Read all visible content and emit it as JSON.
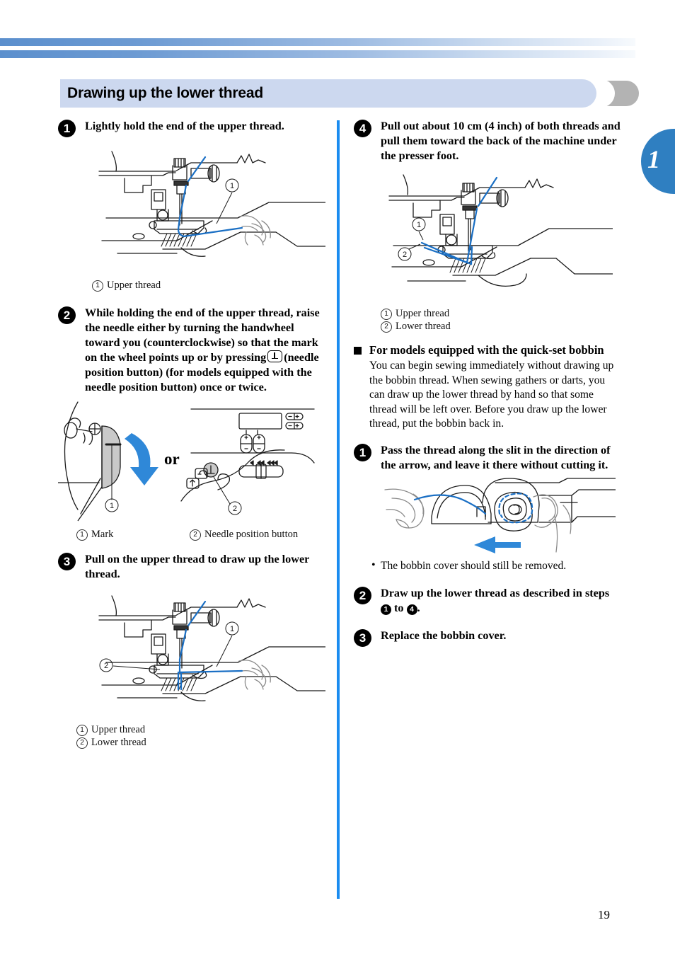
{
  "header": {
    "title": "Drawing up the lower thread",
    "chapter_tab": "1"
  },
  "page_number": "19",
  "left_column": {
    "step1": {
      "badge": "1",
      "text": "Lightly hold the end of the upper thread.",
      "caption": [
        {
          "num": "①",
          "label": "Upper thread"
        }
      ]
    },
    "step2": {
      "badge": "2",
      "text_part1": "While holding the end of the upper thread, raise the needle either by turning the handwheel toward you (counterclockwise) so that the mark on the wheel points up or by pressing",
      "text_part2": "(needle position button) (for models equipped with the needle position button) once or twice.",
      "or_label": "or",
      "caption": [
        {
          "num": "①",
          "label": "Mark"
        },
        {
          "num": "②",
          "label": "Needle position button"
        }
      ]
    },
    "step3": {
      "badge": "3",
      "text": "Pull on the upper thread to draw up the lower thread.",
      "caption": [
        {
          "num": "①",
          "label": "Upper thread"
        },
        {
          "num": "②",
          "label": "Lower thread"
        }
      ]
    }
  },
  "right_column": {
    "step4": {
      "badge": "4",
      "text": "Pull out about 10 cm (4 inch) of both threads and pull them toward the back of the machine under the presser foot.",
      "caption": [
        {
          "num": "①",
          "label": "Upper thread"
        },
        {
          "num": "②",
          "label": "Lower thread"
        }
      ]
    },
    "quickset": {
      "heading": "For models equipped with the quick-set bobbin",
      "body": "You can begin sewing immediately without drawing up the bobbin thread. When sewing gathers or darts, you can draw up the lower thread by hand so that some thread will be left over. Before you draw up the lower thread, put the bobbin back in.",
      "step1": {
        "badge": "1",
        "text": "Pass the thread along the slit in the direction of the arrow, and leave it there without cutting it.",
        "note": "The bobbin cover should still be removed."
      },
      "step2": {
        "badge": "2",
        "text_part1": "Draw up the lower thread as described in steps",
        "ref_from": "1",
        "ref_mid": "to",
        "ref_to": "4",
        "text_part2": "."
      },
      "step3": {
        "badge": "3",
        "text": "Replace the bobbin cover."
      }
    }
  },
  "colors": {
    "thread_blue": "#1a6fc4",
    "divider_blue": "#1a8cf0",
    "header_blue": "#ccd8ef",
    "tab_blue": "#2f7fc1",
    "cap_gray": "#b3b3b3"
  }
}
